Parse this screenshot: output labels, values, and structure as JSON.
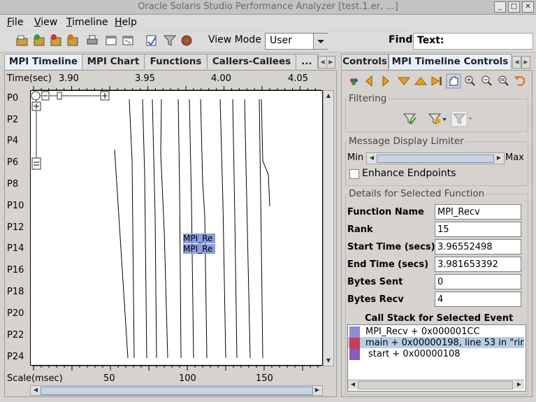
{
  "window": {
    "title": "Oracle Solaris Studio Performance Analyzer [test.1.er, ...]"
  },
  "menu": {
    "file": "File",
    "view": "View",
    "timeline": "Timeline",
    "help": "Help"
  },
  "toolbar": {
    "view_mode_label": "View Mode",
    "view_mode_value": "User",
    "find_label": "Find",
    "text_label": "Text:",
    "text_value": ""
  },
  "left_tabs": [
    "MPI Timeline",
    "MPI Chart",
    "Functions",
    "Callers-Callees",
    "..."
  ],
  "right_tabs": [
    "Controls",
    "MPI Timeline Controls"
  ],
  "timeline": {
    "time_axis_label": "Time(sec)",
    "time_ticks": [
      "3.90",
      "3.95",
      "4.00",
      "4.05"
    ],
    "process_labels": [
      "P0",
      "P2",
      "P4",
      "P6",
      "P8",
      "P10",
      "P12",
      "P14",
      "P16",
      "P18",
      "P20",
      "P22",
      "P24"
    ],
    "scale_label": "Scale(msec)",
    "scale_ticks": [
      "50",
      "100",
      "150"
    ],
    "event_label_1": "MPI_Re",
    "event_label_2": "MPI_Re"
  },
  "controls": {
    "filtering_title": "Filtering",
    "message_limiter_title": "Message Display Limiter",
    "min_label": "Min",
    "max_label": "Max",
    "enhance_endpoints_label": "Enhance Endpoints",
    "enhance_endpoints_checked": false,
    "details_title": "Details for Selected Function",
    "fields": [
      {
        "label": "Function Name",
        "value": "MPI_Recv"
      },
      {
        "label": "Rank",
        "value": "15"
      },
      {
        "label": "Start Time (secs)",
        "value": "3.96552498"
      },
      {
        "label": "End Time (secs)",
        "value": "3.981653392"
      },
      {
        "label": "Bytes Sent",
        "value": "0"
      },
      {
        "label": "Bytes Recv",
        "value": "4"
      }
    ],
    "call_stack_title": "Call Stack for Selected Event",
    "call_stack": [
      {
        "text": "MPI_Recv + 0x000001CC",
        "color": "#8c8cd8"
      },
      {
        "text": "main + 0x00000198, line 53 in \"rin",
        "color": "#c83c5a"
      },
      {
        "text": "start + 0x00000108",
        "color": "#8c5ac0"
      }
    ]
  },
  "colors": {
    "selected_tab": "#e8f0fb",
    "event_fill": "#8c9ce0",
    "selection_bar": "#b8cde6"
  }
}
